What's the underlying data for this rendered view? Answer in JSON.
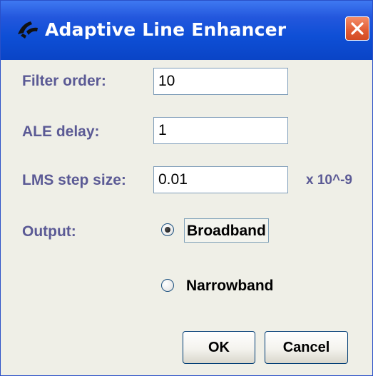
{
  "window": {
    "title": "Adaptive Line Enhancer",
    "title_icon": "window-app-icon",
    "close_icon": "close-icon"
  },
  "form": {
    "filter_order": {
      "label": "Filter order:",
      "value": "10"
    },
    "ale_delay": {
      "label": "ALE delay:",
      "value": "1"
    },
    "lms_step_size": {
      "label": "LMS step size:",
      "value": "0.01",
      "unit": "x 10^-9"
    },
    "output": {
      "label": "Output:",
      "options": [
        {
          "label": "Broadband",
          "selected": true
        },
        {
          "label": "Narrowband",
          "selected": false
        }
      ]
    }
  },
  "buttons": {
    "ok_label": "OK",
    "cancel_label": "Cancel"
  },
  "colors": {
    "titlebar": "#0a44c6",
    "label_text": "#5b5a95",
    "dialog_background": "#efefe7",
    "close_button": "#e25e36"
  }
}
